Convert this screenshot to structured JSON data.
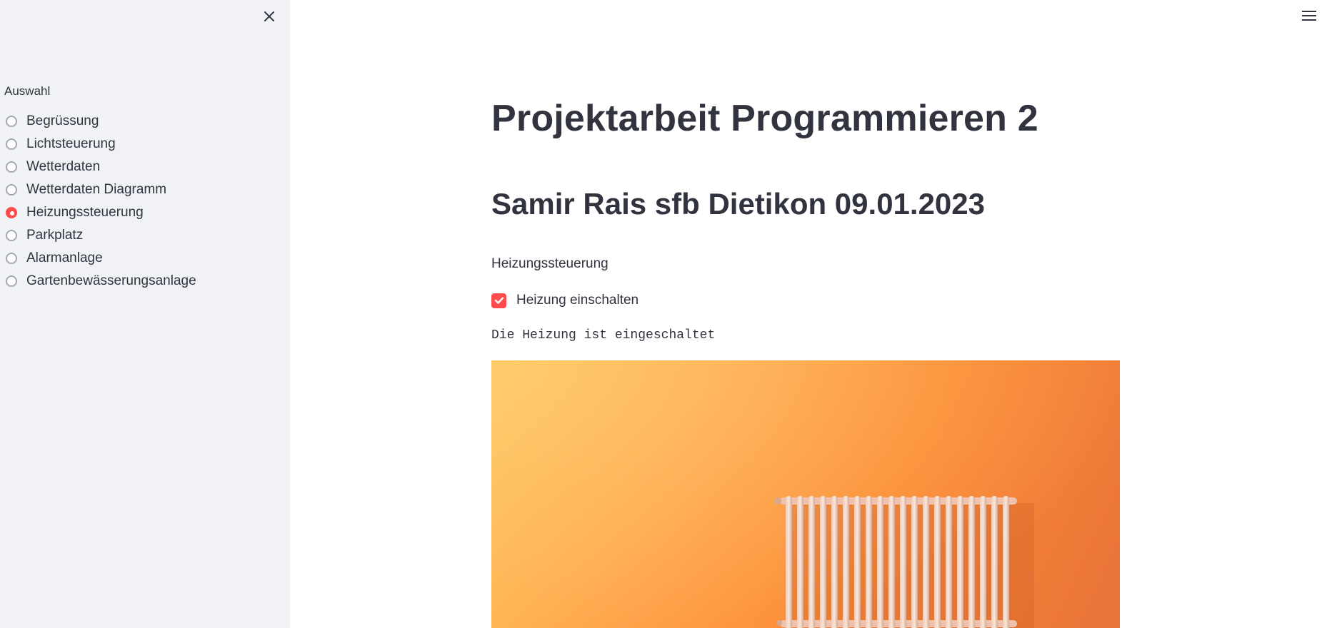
{
  "sidebar": {
    "close_label": "×",
    "radio_label": "Auswahl",
    "items": [
      {
        "label": "Begrüssung",
        "selected": false
      },
      {
        "label": "Lichtsteuerung",
        "selected": false
      },
      {
        "label": "Wetterdaten",
        "selected": false
      },
      {
        "label": "Wetterdaten Diagramm",
        "selected": false
      },
      {
        "label": "Heizungssteuerung",
        "selected": true
      },
      {
        "label": "Parkplatz",
        "selected": false
      },
      {
        "label": "Alarmanlage",
        "selected": false
      },
      {
        "label": "Gartenbewässerungsanlage",
        "selected": false
      }
    ]
  },
  "main": {
    "title": "Projektarbeit Programmieren 2",
    "subtitle": "Samir Rais sfb Dietikon 09.01.2023",
    "section_label": "Heizungssteuerung",
    "checkbox": {
      "label": "Heizung einschalten",
      "checked": true
    },
    "status_text": "Die Heizung ist eingeschaltet",
    "image": {
      "subject": "radiator-on-orange-wall"
    }
  },
  "icons": {
    "close": "close-icon",
    "menu": "hamburger-menu-icon",
    "check": "checkmark-icon"
  },
  "colors": {
    "accent": "#ff4b4b",
    "sidebar_bg": "#f0f2f6",
    "text": "#31333f"
  }
}
